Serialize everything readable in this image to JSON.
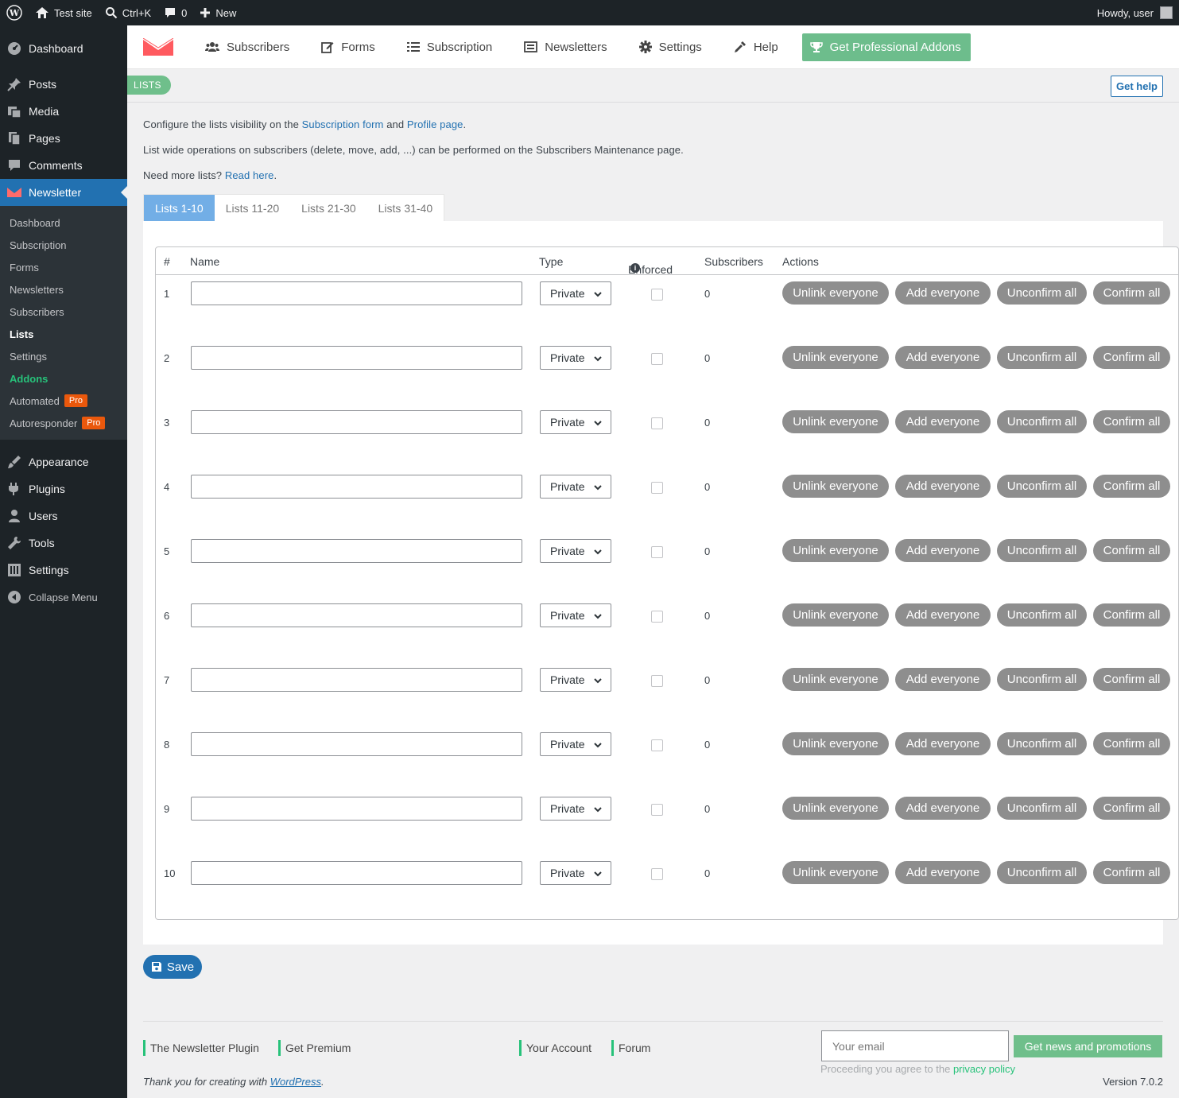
{
  "adminbar": {
    "site_name": "Test site",
    "search_shortcut": "Ctrl+K",
    "comments_count": "0",
    "new_label": "New",
    "howdy": "Howdy, user"
  },
  "sidebar": {
    "top_items": [
      {
        "label": "Dashboard",
        "icon": "dashboard-icon"
      },
      {
        "label": "Posts",
        "icon": "pin-icon"
      },
      {
        "label": "Media",
        "icon": "media-icon"
      },
      {
        "label": "Pages",
        "icon": "pages-icon"
      },
      {
        "label": "Comments",
        "icon": "comment-icon"
      },
      {
        "label": "Newsletter",
        "icon": "newsletter-icon"
      }
    ],
    "sub_items": [
      {
        "label": "Dashboard"
      },
      {
        "label": "Subscription"
      },
      {
        "label": "Forms"
      },
      {
        "label": "Newsletters"
      },
      {
        "label": "Subscribers"
      },
      {
        "label": "Lists"
      },
      {
        "label": "Settings"
      },
      {
        "label": "Addons"
      },
      {
        "label": "Automated",
        "badge": "Pro"
      },
      {
        "label": "Autoresponder",
        "badge": "Pro"
      }
    ],
    "bottom_items": [
      {
        "label": "Appearance",
        "icon": "appearance-icon"
      },
      {
        "label": "Plugins",
        "icon": "plugins-icon"
      },
      {
        "label": "Users",
        "icon": "users-icon"
      },
      {
        "label": "Tools",
        "icon": "tools-icon"
      },
      {
        "label": "Settings",
        "icon": "settings-icon"
      }
    ],
    "collapse_label": "Collapse Menu"
  },
  "tnp_nav": {
    "items": [
      "Subscribers",
      "Forms",
      "Subscription",
      "Newsletters",
      "Settings",
      "Help"
    ],
    "pro_button": "Get Professional Addons"
  },
  "heading": {
    "pill": "LISTS",
    "help_button": "Get help"
  },
  "intro": {
    "line1_pre": "Configure the lists visibility on the ",
    "line1_link1": "Subscription form",
    "line1_mid": " and ",
    "line1_link2": "Profile page",
    "line1_post": ".",
    "line2": "List wide operations on subscribers (delete, move, add, ...) can be performed on the Subscribers Maintenance page.",
    "line3_pre": "Need more lists? ",
    "line3_link": "Read here",
    "line3_post": "."
  },
  "tabs": [
    "Lists 1-10",
    "Lists 11-20",
    "Lists 21-30",
    "Lists 31-40"
  ],
  "table": {
    "headers": {
      "num": "#",
      "name": "Name",
      "type": "Type",
      "enforced": "Enforced",
      "subscribers": "Subscribers",
      "actions": "Actions"
    },
    "rows": [
      {
        "num": "1",
        "name": "",
        "type": "Private",
        "enforced": false,
        "subscribers": "0"
      },
      {
        "num": "2",
        "name": "",
        "type": "Private",
        "enforced": false,
        "subscribers": "0"
      },
      {
        "num": "3",
        "name": "",
        "type": "Private",
        "enforced": false,
        "subscribers": "0"
      },
      {
        "num": "4",
        "name": "",
        "type": "Private",
        "enforced": false,
        "subscribers": "0"
      },
      {
        "num": "5",
        "name": "",
        "type": "Private",
        "enforced": false,
        "subscribers": "0"
      },
      {
        "num": "6",
        "name": "",
        "type": "Private",
        "enforced": false,
        "subscribers": "0"
      },
      {
        "num": "7",
        "name": "",
        "type": "Private",
        "enforced": false,
        "subscribers": "0"
      },
      {
        "num": "8",
        "name": "",
        "type": "Private",
        "enforced": false,
        "subscribers": "0"
      },
      {
        "num": "9",
        "name": "",
        "type": "Private",
        "enforced": false,
        "subscribers": "0"
      },
      {
        "num": "10",
        "name": "",
        "type": "Private",
        "enforced": false,
        "subscribers": "0"
      }
    ],
    "action_labels": [
      "Unlink everyone",
      "Add everyone",
      "Unconfirm all",
      "Confirm all"
    ]
  },
  "save_label": "Save",
  "footer": {
    "links": [
      "The Newsletter Plugin",
      "Get Premium",
      "Your Account",
      "Forum"
    ],
    "email_placeholder": "Your email",
    "news_button": "Get news and promotions",
    "privacy_pre": "Proceeding you agree to the ",
    "privacy_link": "privacy policy",
    "thanks_pre": "Thank you for creating with ",
    "thanks_link": "WordPress",
    "thanks_post": ".",
    "version": "Version 7.0.2"
  },
  "colors": {
    "adminbar_bg": "#1d2327",
    "accent_green": "#6fbf8b",
    "accent_blue": "#2271b1",
    "action_button_gray": "#8e8e8e",
    "pro_badge": "#ea580c"
  }
}
